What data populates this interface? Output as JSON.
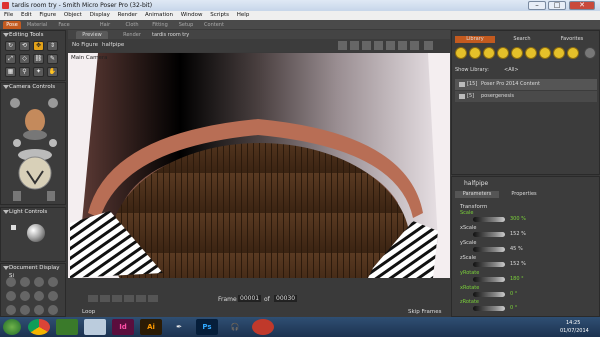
{
  "window": {
    "title": "tardis room try - Smith Micro Poser Pro  (32-bit)",
    "minimize": "–",
    "maximize": "□",
    "close": "✕"
  },
  "menu": [
    "File",
    "Edit",
    "Figure",
    "Object",
    "Display",
    "Render",
    "Animation",
    "Window",
    "Scripts",
    "Help"
  ],
  "main_tabs": [
    "Pose",
    "Material",
    "Face",
    "Hair",
    "Cloth",
    "Fitting",
    "Setup",
    "Content"
  ],
  "left": {
    "editing_tools": "Editing Tools",
    "camera_controls": "Camera Controls",
    "light_controls": "Light Controls",
    "document_display": "Document Display Si"
  },
  "center": {
    "tabs": [
      "Preview",
      "Render"
    ],
    "doc_title": "tardis room try",
    "figure_menu": "No Figure",
    "actor_menu": "halfpipe",
    "camera_label": "Main Camera",
    "frame_label": "Frame",
    "frame_current": "00001",
    "frame_total": "00030",
    "loop_label": "Loop",
    "skip_frames_label": "Skip Frames"
  },
  "library": {
    "tabs": [
      "Library",
      "Search",
      "Favorites"
    ],
    "show_label": "Show Library:",
    "show_value": "<All>",
    "items": [
      {
        "count": "[15]",
        "name": "Poser Pro 2014 Content"
      },
      {
        "count": "[5]",
        "name": "posergenesis"
      }
    ]
  },
  "params": {
    "actor": "halfpipe",
    "tabs": [
      "Parameters",
      "Properties"
    ],
    "section": "Transform",
    "rows": [
      {
        "label": "Scale",
        "value": "300 %",
        "highlight": true
      },
      {
        "label": "xScale",
        "value": "152 %",
        "highlight": false
      },
      {
        "label": "yScale",
        "value": "45 %",
        "highlight": false
      },
      {
        "label": "zScale",
        "value": "152 %",
        "highlight": false
      },
      {
        "label": "yRotate",
        "value": "180 °",
        "highlight": true
      },
      {
        "label": "xRotate",
        "value": "0 °",
        "highlight": true
      },
      {
        "label": "zRotate",
        "value": "0 °",
        "highlight": true
      }
    ]
  },
  "taskbar": {
    "apps": [
      "start",
      "chrome",
      "green-app",
      "paint",
      "indesign",
      "illustrator",
      "feather",
      "photoshop",
      "headphones",
      "poser"
    ],
    "labels": {
      "indesign": "Id",
      "illustrator": "Ai",
      "photoshop": "Ps"
    },
    "time": "14:25",
    "date": "01/07/2014"
  },
  "colors": {
    "accent": "#c35a1f",
    "panel": "#3c3c3c",
    "highlight_green": "#7bd23a",
    "tool_active": "#e3a218"
  }
}
